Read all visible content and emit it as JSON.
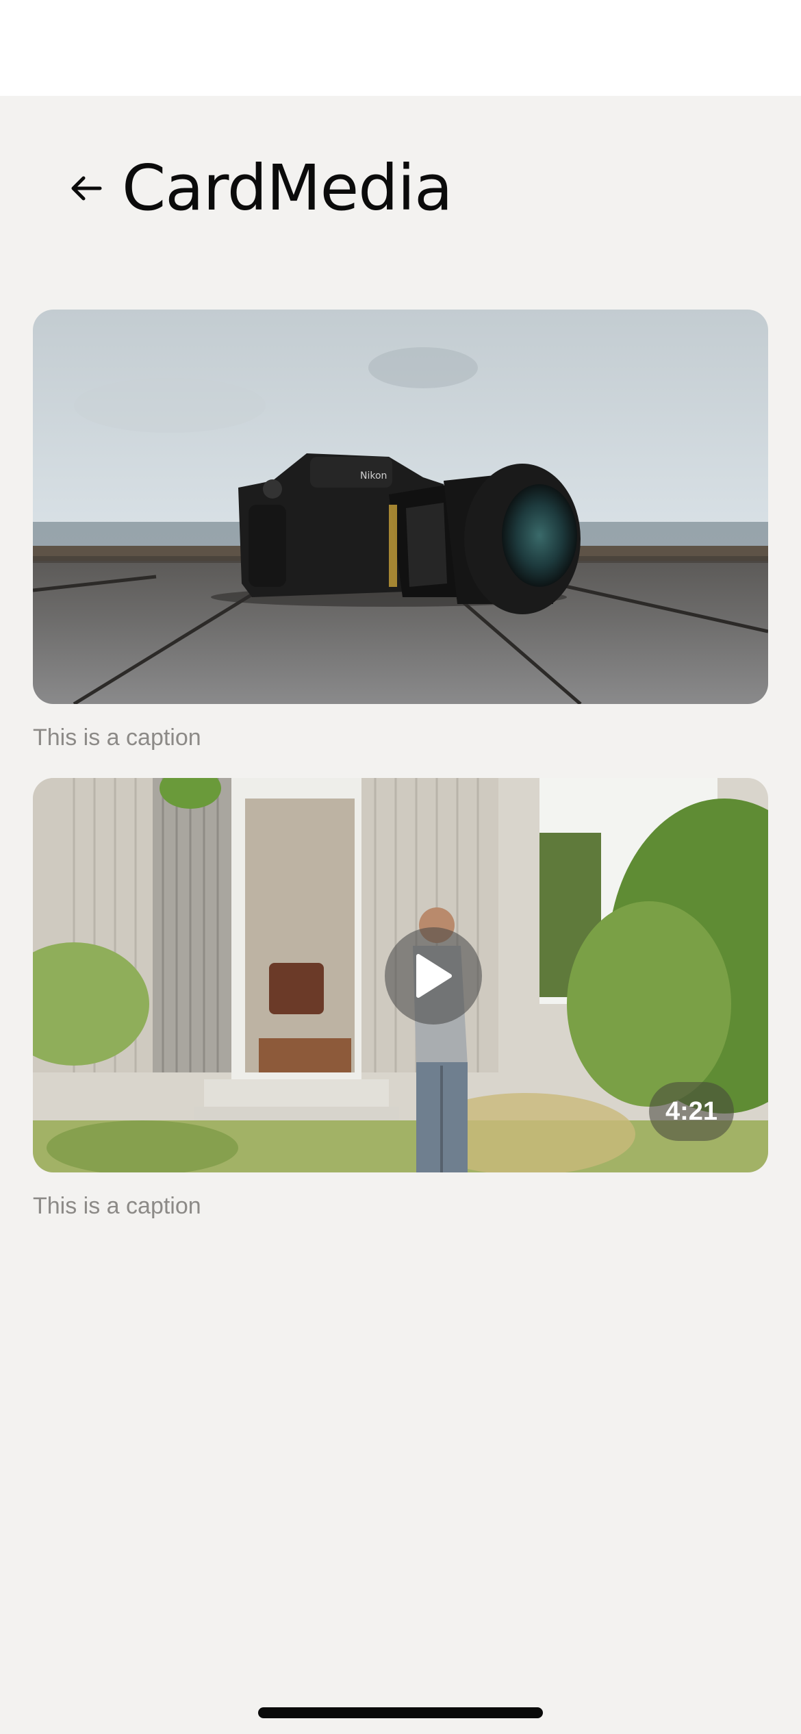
{
  "header": {
    "back_icon": "arrow-left-icon",
    "title": "CardMedia"
  },
  "cards": [
    {
      "media_type": "image",
      "image_subject": "camera on wooden deck",
      "caption": "This is a caption"
    },
    {
      "media_type": "video",
      "image_subject": "man in garden in front of house",
      "play_icon": "play-icon",
      "duration": "4:21",
      "caption": "This is a caption"
    }
  ],
  "colors": {
    "background": "#f3f2f0",
    "title": "#0b0b0b",
    "caption": "#8c8a87"
  }
}
